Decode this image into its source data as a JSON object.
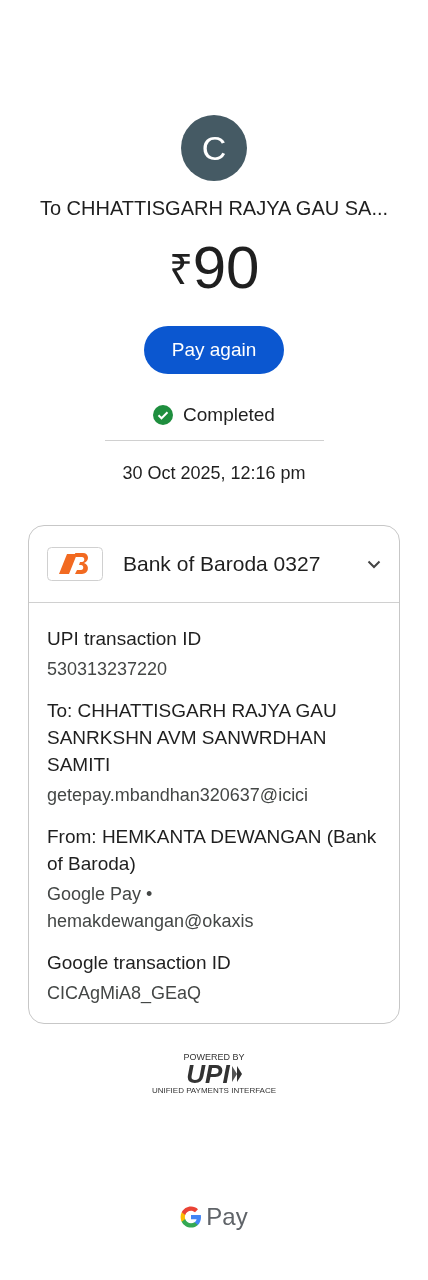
{
  "header": {
    "avatar_letter": "C",
    "recipient": "To CHHATTISGARH RAJYA GAU SA...",
    "currency": "₹",
    "amount": "90",
    "action": "Pay again"
  },
  "status": {
    "kind": "completed",
    "label": "Completed"
  },
  "date": "30 Oct 2025, 12:16 pm",
  "card": {
    "bank": "Bank of Baroda 0327",
    "details": [
      {
        "title": "UPI transaction ID",
        "value": [
          "530313237220"
        ]
      },
      {
        "title": "To: CHHATTISGARH RAJYA GAU SANRKSHN AVM SANWRDHAN SAMITI",
        "value": [
          "getepay.mbandhan320637@icici"
        ]
      },
      {
        "title": "From: HEMKANTA DEWANGAN (Bank of Baroda)",
        "value": [
          "Google Pay •",
          "hemakdewangan@okaxis"
        ]
      },
      {
        "title": "Google transaction ID",
        "value": [
          "CICAgMiA8_GEaQ"
        ]
      }
    ]
  },
  "upi_badge": {
    "top": "POWERED BY",
    "logo": "UPI",
    "bottom": "UNIFIED PAYMENTS INTERFACE"
  },
  "footer": {
    "brand": "Pay"
  }
}
